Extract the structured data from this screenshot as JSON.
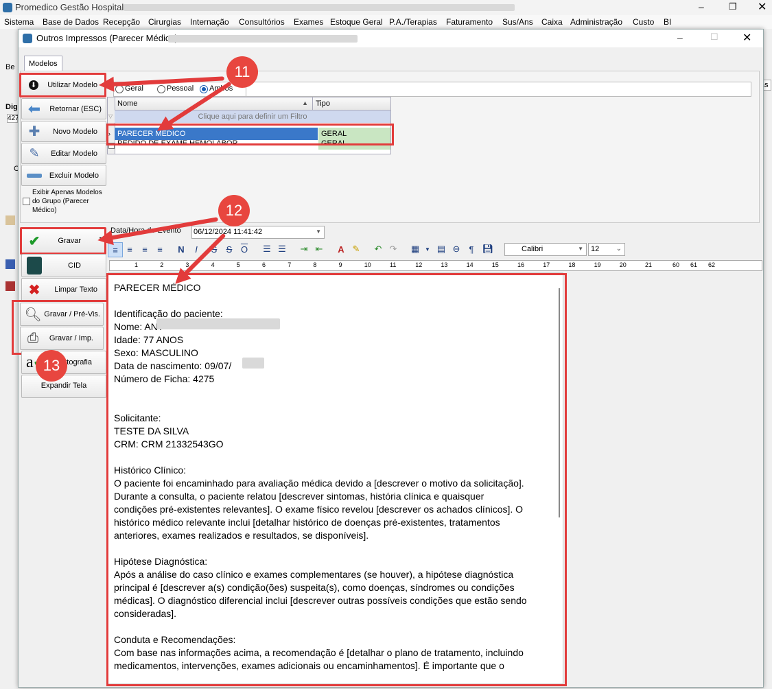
{
  "app": {
    "title": "Promedico Gestão Hospitalar",
    "menu": [
      "Sistema",
      "Base de Dados",
      "Recepção",
      "Cirurgias",
      "Internação",
      "Consultórios",
      "Exames",
      "Estoque Geral",
      "P.A./Terapias",
      "Faturamento",
      "Sus/Ans",
      "Caixa",
      "Administração",
      "Custo",
      "BI"
    ]
  },
  "bg": {
    "tab_be": "Be",
    "digi_label": "Dig",
    "digi_value": "427",
    "side_label": "C",
    "right_tab": "as"
  },
  "dialog": {
    "title": "Outros Impressos (Parecer Médico) -",
    "tab": "Modelos",
    "buttons": {
      "use_model": "Utilizar Modelo",
      "back": "Retornar (ESC)",
      "new_model": "Novo Modelo",
      "edit_model": "Editar Modelo",
      "delete_model": "Excluir Modelo"
    },
    "only_group_label": "Exibir Apenas Modelos do Grupo (Parecer Médico)",
    "filter_radios": [
      "Geral",
      "Pessoal",
      "Ambos"
    ],
    "grid": {
      "columns": [
        "Nome",
        "Tipo"
      ],
      "filter_hint": "Clique aqui para definir um Filtro",
      "rows": [
        {
          "nome": "PARECER MÉDICO",
          "tipo": "GERAL"
        },
        {
          "nome": "PEDIDO DE EXAME HEMOLABOR",
          "tipo": "GERAL"
        }
      ]
    },
    "actions": {
      "save": "Gravar",
      "cid": "CID",
      "clear_text": "Limpar Texto",
      "save_preview": "Gravar / Pré-Vis.",
      "save_print": "Gravar / Imp.",
      "spelling": "Ortografia",
      "expand": "Expandir Tela"
    },
    "event_label": "Data/Hora do Evento",
    "event_value": "06/12/2024 11:41:42",
    "font_name": "Calibri",
    "font_size": "12",
    "ruler_numbers": [
      "1",
      "2",
      "3",
      "4",
      "5",
      "6",
      "7",
      "8",
      "9",
      "10",
      "11",
      "12",
      "13",
      "14",
      "15",
      "16",
      "17",
      "18",
      "19",
      "20",
      "21",
      "60",
      "61",
      "62"
    ],
    "editor_lines": [
      "PARECER MÉDICO",
      "",
      "Identificação do paciente:",
      "Nome: ANT",
      "Idade: 77 ANOS",
      "Sexo: MASCULINO",
      "Data de nascimento: 09/07/",
      "Número de Ficha: 4275",
      "",
      "",
      "Solicitante:",
      "TESTE DA SILVA",
      "CRM: CRM 21332543GO",
      "",
      "Histórico Clínico:",
      "O paciente foi encaminhado para avaliação médica devido a [descrever o motivo da solicitação].",
      "Durante a consulta, o paciente relatou [descrever sintomas, história clínica e quaisquer",
      "condições pré-existentes relevantes]. O exame físico revelou [descrever os achados clínicos]. O",
      "histórico médico relevante inclui [detalhar histórico de doenças pré-existentes, tratamentos",
      "anteriores, exames realizados e resultados, se disponíveis].",
      "",
      "Hipótese Diagnóstica:",
      "Após a análise do caso clínico e exames complementares (se houver), a hipótese diagnóstica",
      "principal é [descrever a(s) condição(ões) suspeita(s), como doenças, síndromes ou condições",
      "médicas]. O diagnóstico diferencial inclui [descrever outras possíveis condições que estão sendo",
      "consideradas].",
      "",
      "Conduta e Recomendações:",
      "Com base nas informações acima, a recomendação é [detalhar o plano de tratamento, incluindo",
      "medicamentos, intervenções, exames adicionais ou encaminhamentos]. É importante que o"
    ]
  },
  "annotations": {
    "step11": "11",
    "step12": "12",
    "step13": "13"
  },
  "colors": {
    "highlight_red": "#e23b3b",
    "badge_red": "#e8463f",
    "selected_row": "#3a78c9",
    "tipo_green": "#c9e6c2"
  }
}
